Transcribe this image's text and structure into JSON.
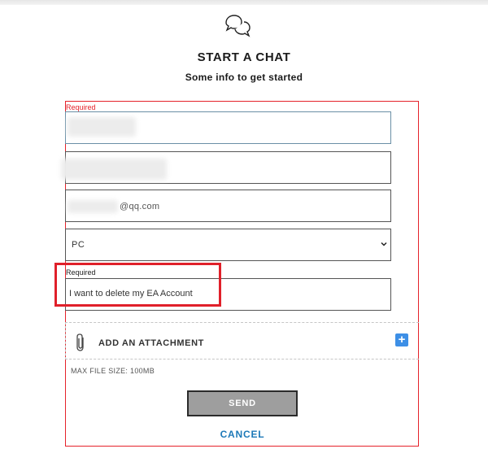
{
  "header": {
    "icon": "chat-bubbles-icon",
    "title": "START A CHAT",
    "subtitle": "Some info to get started"
  },
  "form": {
    "required_label_top": "Required",
    "name_field_value": "",
    "second_field_value": "",
    "email_field_value": "@qq.com",
    "platform_select_value": "PC",
    "required_label_message": "Required",
    "message_value": "I want to delete my EA Account",
    "attachment_label": "ADD AN ATTACHMENT",
    "attachment_icon": "paperclip-icon",
    "add_icon": "plus-icon",
    "max_file_size": "MAX FILE SIZE: 100MB",
    "send_label": "SEND",
    "cancel_label": "CANCEL"
  },
  "colors": {
    "outline_red": "#e5222a",
    "send_bg": "#9e9e9e",
    "cancel_blue": "#1d79b8",
    "plus_blue": "#3d8fe6"
  }
}
